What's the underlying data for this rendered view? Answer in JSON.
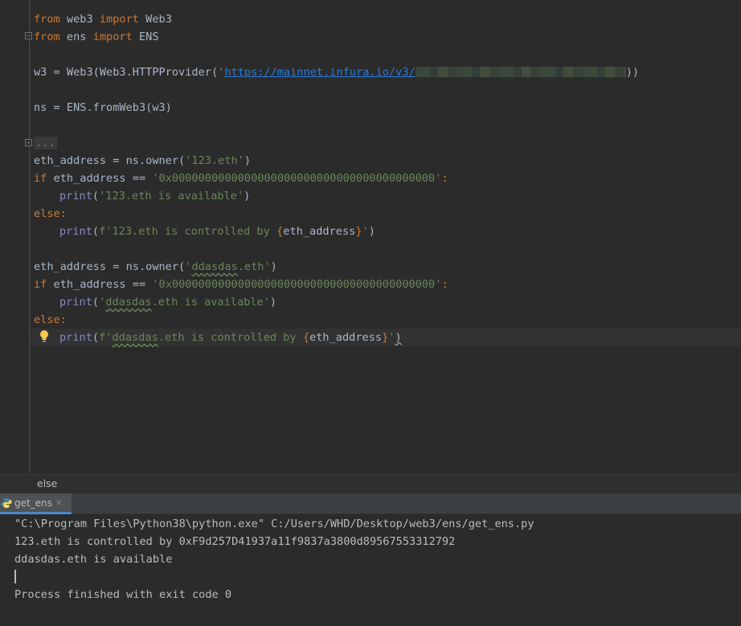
{
  "editor": {
    "lines": {
      "l1_kw": "from",
      "l1_mod": " web3 ",
      "l1_kw2": "import",
      "l1_name": " Web3",
      "l2_kw": "from",
      "l2_mod": " ens ",
      "l2_kw2": "import",
      "l2_name": " ENS",
      "l3_pre": "w3 = Web3(Web3.HTTPProvider(",
      "l3_q": "'",
      "l3_url": "https://mainnet.infura.io/v3/",
      "l3_post": "))",
      "l4": "ns = ENS.fromWeb3(w3)",
      "l5_fold": "...",
      "l6_pre": "eth_address = ns.owner(",
      "l6_str": "'123.eth'",
      "l6_post": ")",
      "l7_kw": "if",
      "l7_mid": " eth_address == ",
      "l7_str": "'0x0000000000000000000000000000000000000000'",
      "l7_post": ":",
      "l8_fn": "print",
      "l8_open": "(",
      "l8_str": "'123.eth is available'",
      "l8_close": ")",
      "l9_kw": "else",
      "l9_post": ":",
      "l10_fn": "print",
      "l10_open": "(",
      "l10_f": "f'123.eth is controlled by ",
      "l10_b1": "{",
      "l10_var": "eth_address",
      "l10_b2": "}",
      "l10_q": "'",
      "l10_close": ")",
      "l11_pre": "eth_address = ns.owner(",
      "l11_q1": "'",
      "l11_typo": "ddasdas",
      "l11_str": ".eth'",
      "l11_post": ")",
      "l12_kw": "if",
      "l12_mid": " eth_address == ",
      "l12_str": "'0x0000000000000000000000000000000000000000'",
      "l12_post": ":",
      "l13_fn": "print",
      "l13_open": "(",
      "l13_q1": "'",
      "l13_typo": "ddasdas",
      "l13_str": ".eth is available'",
      "l13_close": ")",
      "l14_kw": "else",
      "l14_post": ":",
      "l15_fn": "print",
      "l15_open": "(",
      "l15_f": "f'",
      "l15_typo": "ddasdas",
      "l15_str": ".eth is controlled by ",
      "l15_b1": "{",
      "l15_var": "eth_address",
      "l15_b2": "}",
      "l15_q": "'",
      "l15_close": ")"
    }
  },
  "breadcrumb": {
    "text": "else"
  },
  "run_panel": {
    "tab_label": "get_ens",
    "tab_close": "×",
    "output": [
      "\"C:\\Program Files\\Python38\\python.exe\" C:/Users/WHD/Desktop/web3/ens/get_ens.py",
      "123.eth is controlled by 0xF9d257D41937a11f9837a3800d89567553312792",
      "ddasdas.eth is available",
      "Process finished with exit code 0"
    ]
  },
  "icons": {
    "bulb": "lightbulb-icon",
    "python": "python-icon",
    "fold": "fold-icon"
  },
  "colors": {
    "background": "#2b2b2b",
    "keyword": "#cc7832",
    "string": "#6a8759",
    "builtin": "#8888c6",
    "text": "#a9b7c6",
    "url": "#287bde",
    "tab_accent": "#4a88c7"
  }
}
